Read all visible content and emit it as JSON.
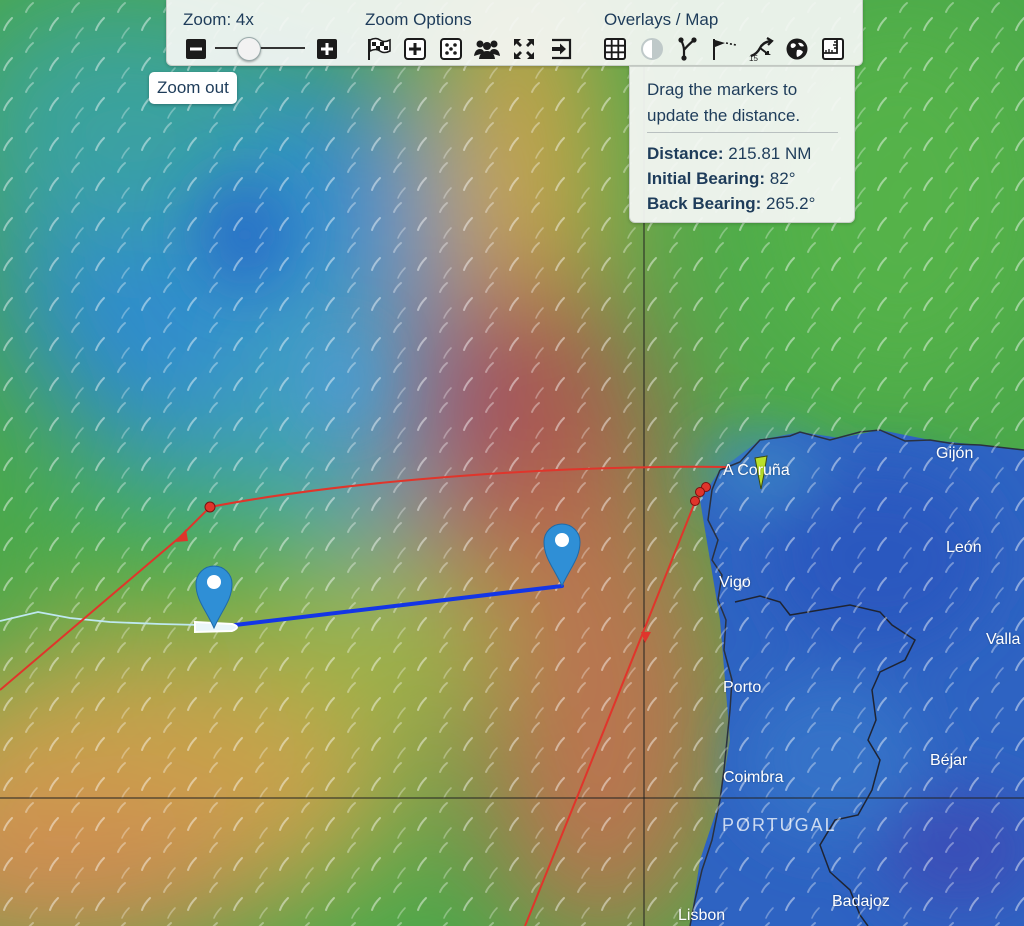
{
  "toolbar": {
    "zoom_label": "Zoom: 4x",
    "zoom_options_label": "Zoom Options",
    "overlays_label": "Overlays / Map",
    "zoom_out_icon": "minus-square-icon",
    "zoom_in_icon": "plus-square-icon",
    "zoom_option_icons": [
      "checkered-flag-icon",
      "plus-box-icon",
      "dice-icon",
      "group-icon",
      "expand-icon",
      "exit-arrow-icon"
    ],
    "overlay_icons": [
      "grid-icon",
      "day-night-icon",
      "route-fork-icon",
      "wind-flag-icon",
      "route-time-icon",
      "globe-icon",
      "ruler-icon"
    ],
    "route_time_icon_badge": "15"
  },
  "tooltip": {
    "text": "Zoom out"
  },
  "distance_panel": {
    "hint": "Drag the markers to update the distance.",
    "distance_label": "Distance:",
    "distance_value": "215.81 NM",
    "initial_bearing_label": "Initial Bearing:",
    "initial_bearing_value": "82°",
    "back_bearing_label": "Back Bearing:",
    "back_bearing_value": "265.2°"
  },
  "map": {
    "cities": [
      "A Coruña",
      "Gijón",
      "León",
      "Vigo",
      "Valla",
      "Porto",
      "Béjar",
      "Coimbra",
      "Badajoz",
      "Lisbon"
    ],
    "country": "PORTUGAL",
    "colors": {
      "route_red": "#e0352b",
      "measure_line": "#1436e6",
      "marker_blue": "#2f8fd6",
      "boat_marker": "#b9e02a"
    }
  }
}
